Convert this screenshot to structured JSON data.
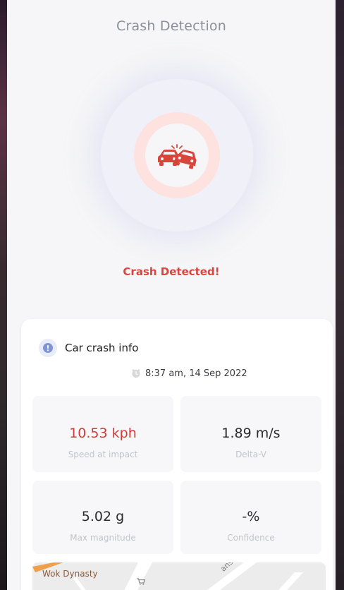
{
  "header": {
    "title": "Crash Detection"
  },
  "status": {
    "text": "Crash Detected!"
  },
  "icons": {
    "crash": "car-collision-icon",
    "info": "info-icon",
    "clock": "clock-icon",
    "cart": "shopping-cart-icon"
  },
  "colors": {
    "alert_red": "#d8453c",
    "ring_pink": "#fde2df",
    "info_blue": "#7f95d8",
    "map_orange": "#f0a04b"
  },
  "card": {
    "title": "Car crash info",
    "timestamp": "8:37 am, 14 Sep 2022",
    "metrics": [
      {
        "value": "10.53 kph",
        "label": "Speed at impact"
      },
      {
        "value": "1.89 m/s",
        "label": "Delta-V"
      },
      {
        "value": "5.02 g",
        "label": "Max magnitude"
      },
      {
        "value": "-%",
        "label": "Confidence"
      }
    ],
    "map": {
      "place": "Wok Dynasty",
      "street": "ansdret"
    }
  }
}
